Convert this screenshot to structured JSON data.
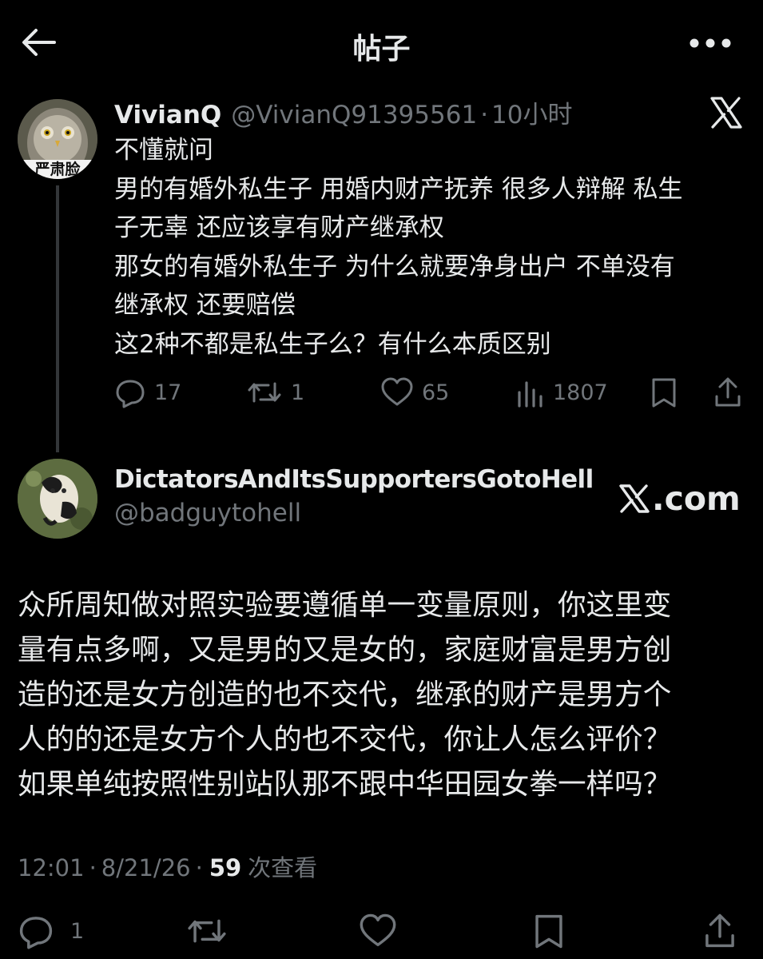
{
  "header": {
    "title": "帖子",
    "back_icon": "arrow-left-icon",
    "more_icon": "more-horizontal-icon"
  },
  "parent_tweet": {
    "display_name": "VivianQ",
    "handle": "@VivianQ91395561",
    "separator": "·",
    "time": "10小时",
    "avatar_icon": "owl-avatar",
    "avatar_text": "严肃脸",
    "lines": [
      "不懂就问",
      "男的有婚外私生子 用婚内财产抚养 很多人辩解 私生",
      "子无辜 还应该享有财产继承权",
      "那女的有婚外私生子 为什么就要净身出户 不单没有",
      "继承权 还要赔偿",
      "这2种不都是私生子么？有什么本质区别"
    ],
    "stats": {
      "replies": "17",
      "reposts": "1",
      "likes": "65",
      "views": "1807"
    }
  },
  "reply_tweet": {
    "display_name": "DictatorsAndItsSupportersGotoHell",
    "handle": "@badguytohell",
    "avatar_icon": "cat-avatar",
    "lines": [
      "众所周知做对照实验要遵循单一变量原则，你这里变",
      "量有点多啊，又是男的又是女的，家庭财富是男方创",
      "造的还是女方创造的也不交代，继承的财产是男方个",
      "人的的还是女方个人的也不交代，你让人怎么评价？",
      "如果单纯按照性别站队那不跟中华田园女拳一样吗？"
    ],
    "time": "12:01",
    "dot": "·",
    "date": "8/21/26",
    "view_count": "59",
    "view_label": "次查看",
    "replies": "1"
  },
  "watermark": {
    "label": ".com"
  },
  "colors": {
    "background": "#000000",
    "text": "#e7e9ea",
    "muted": "#71767b",
    "thread_line": "#333639"
  }
}
